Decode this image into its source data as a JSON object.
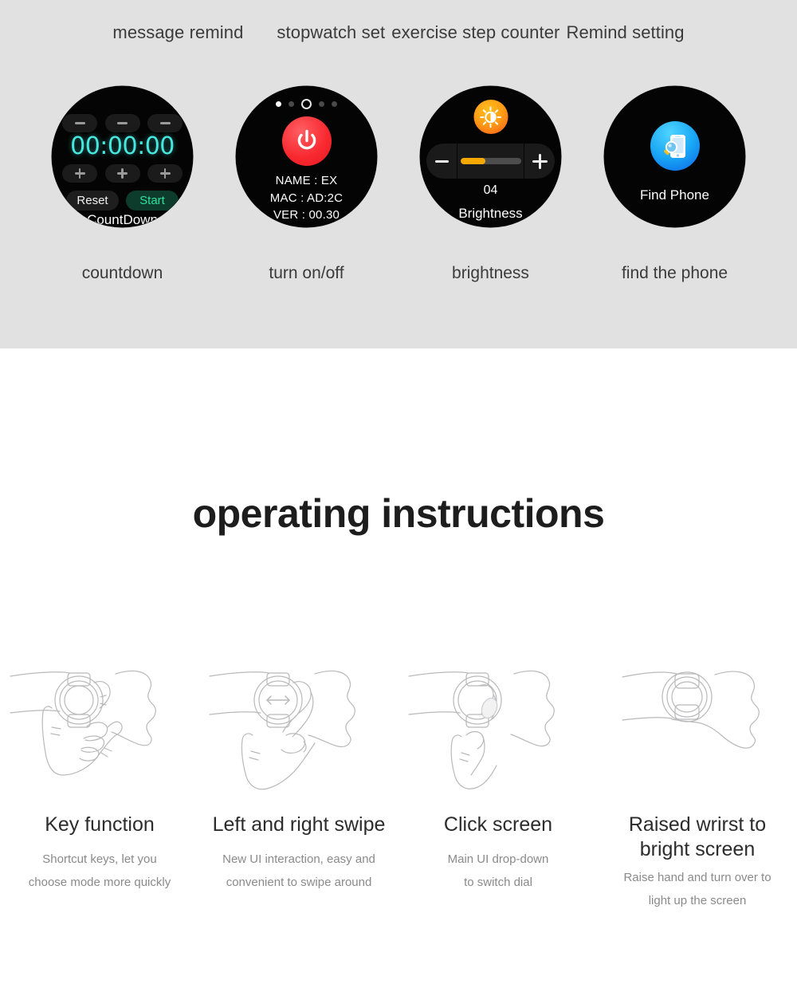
{
  "features": {
    "headings": [
      {
        "label": "message remind"
      },
      {
        "label": "stopwatch set"
      },
      {
        "label": "exercise step counter"
      },
      {
        "label": "Remind setting"
      }
    ],
    "colors": {
      "panel_background": "#e1e1e1",
      "watch_background": "#040404",
      "timer_cyan": "#46e7de",
      "start_green": "#2ce0a0",
      "power_red": "#f8282f",
      "brightness_orange": "#f5a800",
      "find_phone_blue": "#19a6f5"
    },
    "watches": [
      {
        "caption": "countdown",
        "icon": "countdown-watch-face",
        "time": "00:00:00",
        "decrement_labels": [
          "−",
          "−",
          "−"
        ],
        "increment_labels": [
          "+",
          "+",
          "+"
        ],
        "reset_label": "Reset",
        "start_label": "Start",
        "screen_label": "CountDown"
      },
      {
        "caption": "turn on/off",
        "icon": "power-watch-face",
        "pager_dots": [
          "filled",
          "dim",
          "ring",
          "dim",
          "dim"
        ],
        "power_icon": "power-icon",
        "info_lines": [
          "NAME : EX",
          "MAC : AD:2C",
          "VER : 00.30"
        ]
      },
      {
        "caption": "brightness",
        "icon": "brightness-watch-face",
        "sun_icon": "brightness-sun-icon",
        "minus_label": "−",
        "plus_label": "+",
        "slider_percent": 42,
        "value": "04",
        "screen_label": "Brightness"
      },
      {
        "caption": "find the phone",
        "icon": "find-phone-watch-face",
        "phone_icon": "find-phone-icon",
        "screen_label": "Find Phone"
      }
    ]
  },
  "section": {
    "title": "operating instructions"
  },
  "instructions": [
    {
      "icon": "hand-press-button-illustration",
      "title": "Key function",
      "description": "Shortcut keys, let you\nchoose mode more quickly"
    },
    {
      "icon": "swipe-left-right-illustration",
      "title": "Left and right swipe",
      "description": "New UI interaction, easy and\nconvenient to swipe around"
    },
    {
      "icon": "tap-screen-illustration",
      "title": "Click screen",
      "description": "Main UI drop-down\nto switch dial"
    },
    {
      "icon": "raise-wrist-illustration",
      "title": "Raised wrirst to\nbright screen",
      "description": "Raise hand and turn over to\nlight up the screen"
    }
  ]
}
